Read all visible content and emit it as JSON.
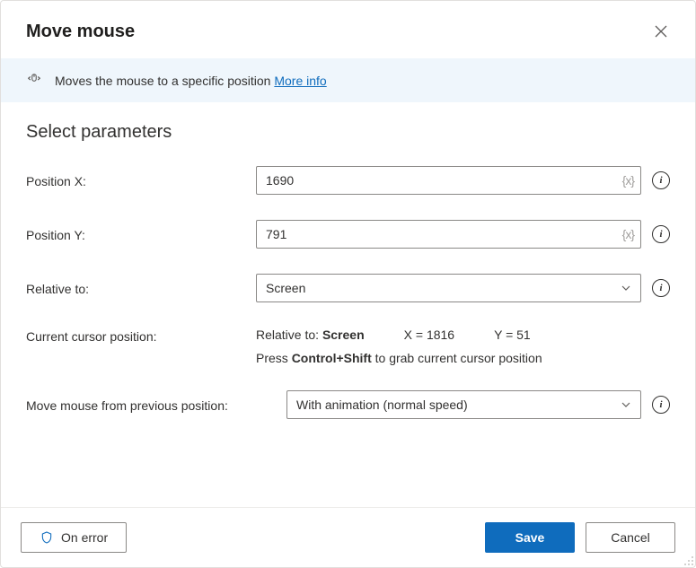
{
  "header": {
    "title": "Move mouse"
  },
  "info": {
    "text": "Moves the mouse to a specific position",
    "more_info": "More info"
  },
  "section": {
    "title": "Select parameters"
  },
  "fields": {
    "posx": {
      "label": "Position X:",
      "value": "1690"
    },
    "posy": {
      "label": "Position Y:",
      "value": "791"
    },
    "relative": {
      "label": "Relative to:",
      "value": "Screen"
    },
    "cursor": {
      "label": "Current cursor position:",
      "relative_label": "Relative to:",
      "relative_value": "Screen",
      "x_label": "X =",
      "x_value": "1816",
      "y_label": "Y =",
      "y_value": "51",
      "hint_prefix": "Press ",
      "hint_keys": "Control+Shift",
      "hint_suffix": " to grab current cursor position"
    },
    "movemode": {
      "label": "Move mouse from previous position:",
      "value": "With animation (normal speed)"
    }
  },
  "footer": {
    "on_error": "On error",
    "save": "Save",
    "cancel": "Cancel"
  },
  "tokens": {
    "var": "{x}"
  }
}
